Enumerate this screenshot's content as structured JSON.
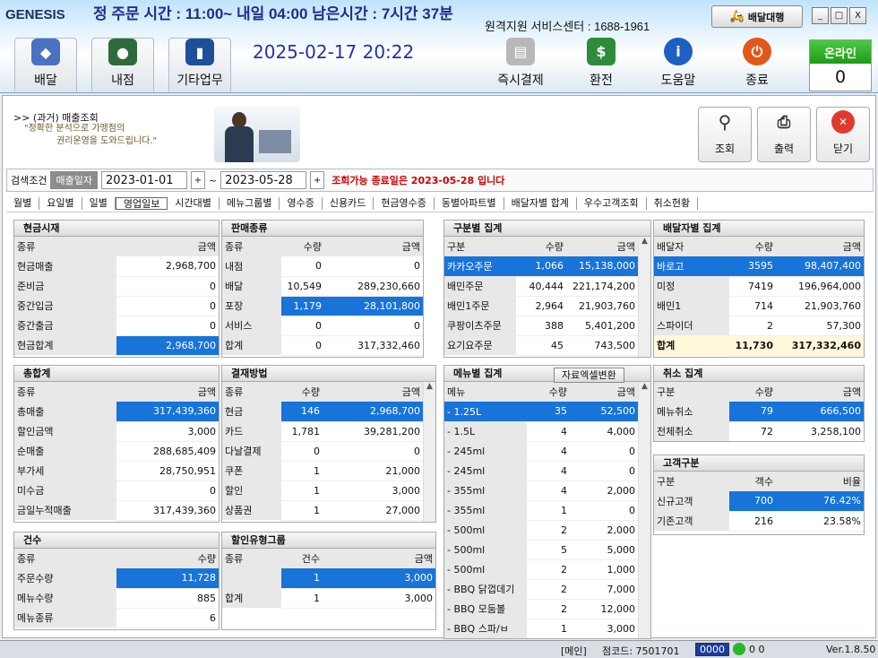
{
  "header": {
    "logo": "GENESIS",
    "marquee": "정 주문 시간 : 11:00~ 내일 04:00   남은시간 : 7시간 37분",
    "support": "원격지원 서비스센터 : 1688-1961",
    "delivery_btn": "배달대행",
    "window_controls": [
      "_",
      "□",
      "X"
    ],
    "datetime": "2025-02-17 20:22",
    "online_label": "온라인",
    "online_count": "0",
    "nav": [
      {
        "label": "배달",
        "icon": "cube-icon",
        "color": "#4a72c4"
      },
      {
        "label": "내점",
        "icon": "person-icon",
        "color": "#2f6b3a"
      },
      {
        "label": "기타업무",
        "icon": "book-icon",
        "color": "#1e4f9a"
      },
      {
        "label": "즉시결제",
        "icon": "card-terminal-icon",
        "color": "#b8b8b8"
      },
      {
        "label": "환전",
        "icon": "money-icon",
        "color": "#2c8c3c"
      },
      {
        "label": "도움말",
        "icon": "info-icon",
        "color": "#1d5fc2"
      },
      {
        "label": "종료",
        "icon": "power-icon",
        "color": "#e2571a"
      }
    ]
  },
  "page": {
    "breadcrumb": ">> (과거) 매출조회",
    "slogan1": "\"정확한 분석으로 가맹점의",
    "slogan2": "권리운영을 도와드립니다.\"",
    "actions": {
      "search": "조회",
      "print": "출력",
      "close": "닫기"
    }
  },
  "search": {
    "label": "검색조건",
    "date_type": "매출일자",
    "from": "2023-01-01",
    "to": "2023-05-28",
    "tilde": "~",
    "plus": "+",
    "warning": "조회가능 종료일은 2023-05-28 입니다"
  },
  "tabs": [
    "월별",
    "요일별",
    "일별",
    "영업일보",
    "시간대별",
    "메뉴그룹별",
    "영수증",
    "신용카드",
    "현금영수증",
    "동별아파트별",
    "배달자별 합계",
    "우수고객조회",
    "취소현황"
  ],
  "cash": {
    "title": "현금시재",
    "h1": "종류",
    "h2": "금액",
    "rows": [
      [
        "현금매출",
        "2,968,700"
      ],
      [
        "준비금",
        "0"
      ],
      [
        "중간입금",
        "0"
      ],
      [
        "중간출금",
        "0"
      ],
      [
        "현금합계",
        "2,968,700"
      ]
    ]
  },
  "sales_type": {
    "title": "판매종류",
    "h1": "종류",
    "h2": "수량",
    "h3": "금액",
    "rows": [
      [
        "내점",
        "0",
        "0"
      ],
      [
        "배달",
        "10,549",
        "289,230,660"
      ],
      [
        "포장",
        "1,179",
        "28,101,800"
      ],
      [
        "서비스",
        "0",
        "0"
      ],
      [
        "합계",
        "0",
        "317,332,460"
      ]
    ]
  },
  "category": {
    "title": "구분별 집계",
    "h1": "구분",
    "h2": "수량",
    "h3": "금액",
    "rows": [
      [
        "카카오주문",
        "1,066",
        "15,138,000"
      ],
      [
        "배민주문",
        "40,444",
        "221,174,200"
      ],
      [
        "배민1주문",
        "2,964",
        "21,903,760"
      ],
      [
        "쿠팡이츠주문",
        "388",
        "5,401,200"
      ],
      [
        "요기요주문",
        "45",
        "743,500"
      ]
    ]
  },
  "delivery": {
    "title": "배달자별 집계",
    "h1": "배달자",
    "h2": "수량",
    "h3": "금액",
    "rows": [
      [
        "바로고",
        "3595",
        "98,407,400"
      ],
      [
        "미정",
        "7419",
        "196,964,000"
      ],
      [
        "배민1",
        "714",
        "21,903,760"
      ],
      [
        "스파이더",
        "2",
        "57,300"
      ],
      [
        "합계",
        "11,730",
        "317,332,460"
      ]
    ]
  },
  "total": {
    "title": "총합계",
    "h1": "종류",
    "h2": "금액",
    "rows": [
      [
        "총매출",
        "317,439,360"
      ],
      [
        "할인금액",
        "3,000"
      ],
      [
        "순매출",
        "288,685,409"
      ],
      [
        "부가세",
        "28,750,951"
      ],
      [
        "미수금",
        "0"
      ],
      [
        "금일누적매출",
        "317,439,360"
      ]
    ]
  },
  "payment": {
    "title": "결재방법",
    "h1": "종류",
    "h2": "수량",
    "h3": "금액",
    "rows": [
      [
        "현금",
        "146",
        "2,968,700"
      ],
      [
        "카드",
        "1,781",
        "39,281,200"
      ],
      [
        "다날결제",
        "0",
        "0"
      ],
      [
        "쿠폰",
        "1",
        "21,000"
      ],
      [
        "할인",
        "1",
        "3,000"
      ],
      [
        "상품권",
        "1",
        "27,000"
      ]
    ]
  },
  "menu": {
    "title": "메뉴별 집계",
    "excel": "자료엑셀변환",
    "h1": "메뉴",
    "h2": "수량",
    "h3": "금액",
    "rows": [
      [
        "- 1.25L",
        "35",
        "52,500"
      ],
      [
        "- 1.5L",
        "4",
        "4,000"
      ],
      [
        "- 245ml",
        "4",
        "0"
      ],
      [
        "- 245ml",
        "4",
        "0"
      ],
      [
        "- 355ml",
        "4",
        "2,000"
      ],
      [
        "- 355ml",
        "1",
        "0"
      ],
      [
        "- 500ml",
        "2",
        "2,000"
      ],
      [
        "- 500ml",
        "5",
        "5,000"
      ],
      [
        "- 500ml",
        "2",
        "1,000"
      ],
      [
        "- BBQ 닭껍데기",
        "2",
        "7,000"
      ],
      [
        "- BBQ 모둠볼",
        "2",
        "12,000"
      ],
      [
        "- BBQ 스파/ㅂ",
        "1",
        "3,000"
      ]
    ]
  },
  "cancel": {
    "title": "취소 집계",
    "h1": "구분",
    "h2": "수량",
    "h3": "금액",
    "rows": [
      [
        "메뉴취소",
        "79",
        "666,500"
      ],
      [
        "전체취소",
        "72",
        "3,258,100"
      ]
    ]
  },
  "customer": {
    "title": "고객구분",
    "h1": "구분",
    "h2": "객수",
    "h3": "비율",
    "rows": [
      [
        "신규고객",
        "700",
        "76.42%"
      ],
      [
        "기존고객",
        "216",
        "23.58%"
      ]
    ]
  },
  "count": {
    "title": "건수",
    "h1": "종류",
    "h2": "수량",
    "rows": [
      [
        "주문수량",
        "11,728"
      ],
      [
        "메뉴수량",
        "885"
      ],
      [
        "메뉴종류",
        "6"
      ]
    ]
  },
  "discount": {
    "title": "할인유형그룹",
    "h1": "종류",
    "h2": "건수",
    "h3": "금액",
    "rows": [
      [
        "",
        "1",
        "3,000"
      ],
      [
        "합계",
        "1",
        "3,000"
      ]
    ]
  },
  "status": {
    "mode": "[메인]",
    "store": "점코드: 7501701",
    "box": "0000",
    "light": "0 0",
    "version": "Ver.1.8.50"
  }
}
